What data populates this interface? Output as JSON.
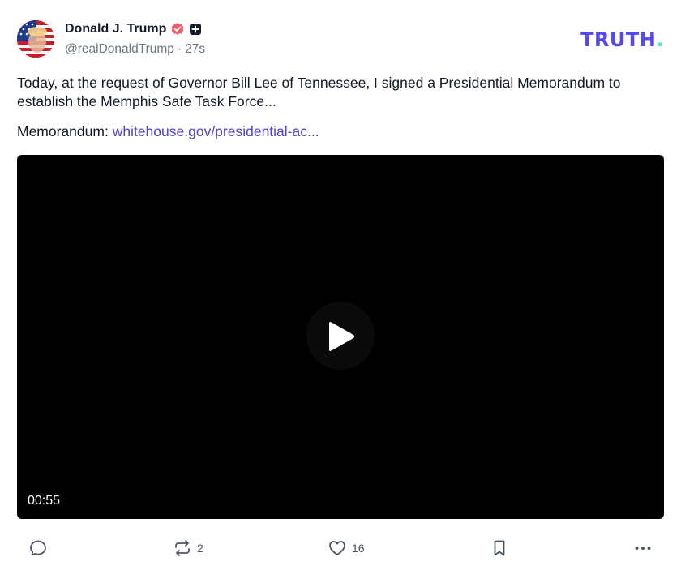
{
  "post": {
    "author": {
      "display_name": "Donald J. Trump",
      "handle": "@realDonaldTrump",
      "separator": "·",
      "time_ago": "27s",
      "verified_icon": "verified-badge-icon",
      "plus_icon": "plus-badge-icon",
      "avatar": "profile-avatar"
    },
    "brand": {
      "logo_text": "TRUTH",
      "logo_dot": ".",
      "logo_color": "#5448ee",
      "logo_dot_color": "#5ce5ce"
    },
    "text": "Today, at the request of Governor Bill Lee of Tennessee, I signed a Presidential Memorandum to establish the Memphis Safe Task Force...",
    "memo_label": "Memorandum:",
    "memo_link": "whitehouse.gov/presidential-ac...",
    "link_color": "#4f46c8",
    "video": {
      "duration": "00:55",
      "play_icon": "play-icon"
    },
    "actions": {
      "reply": {
        "icon": "reply-icon",
        "count": ""
      },
      "repost": {
        "icon": "repost-icon",
        "count": "2"
      },
      "like": {
        "icon": "heart-icon",
        "count": "16"
      },
      "bookmark": {
        "icon": "bookmark-icon",
        "count": ""
      },
      "more": {
        "icon": "more-icon"
      }
    }
  }
}
